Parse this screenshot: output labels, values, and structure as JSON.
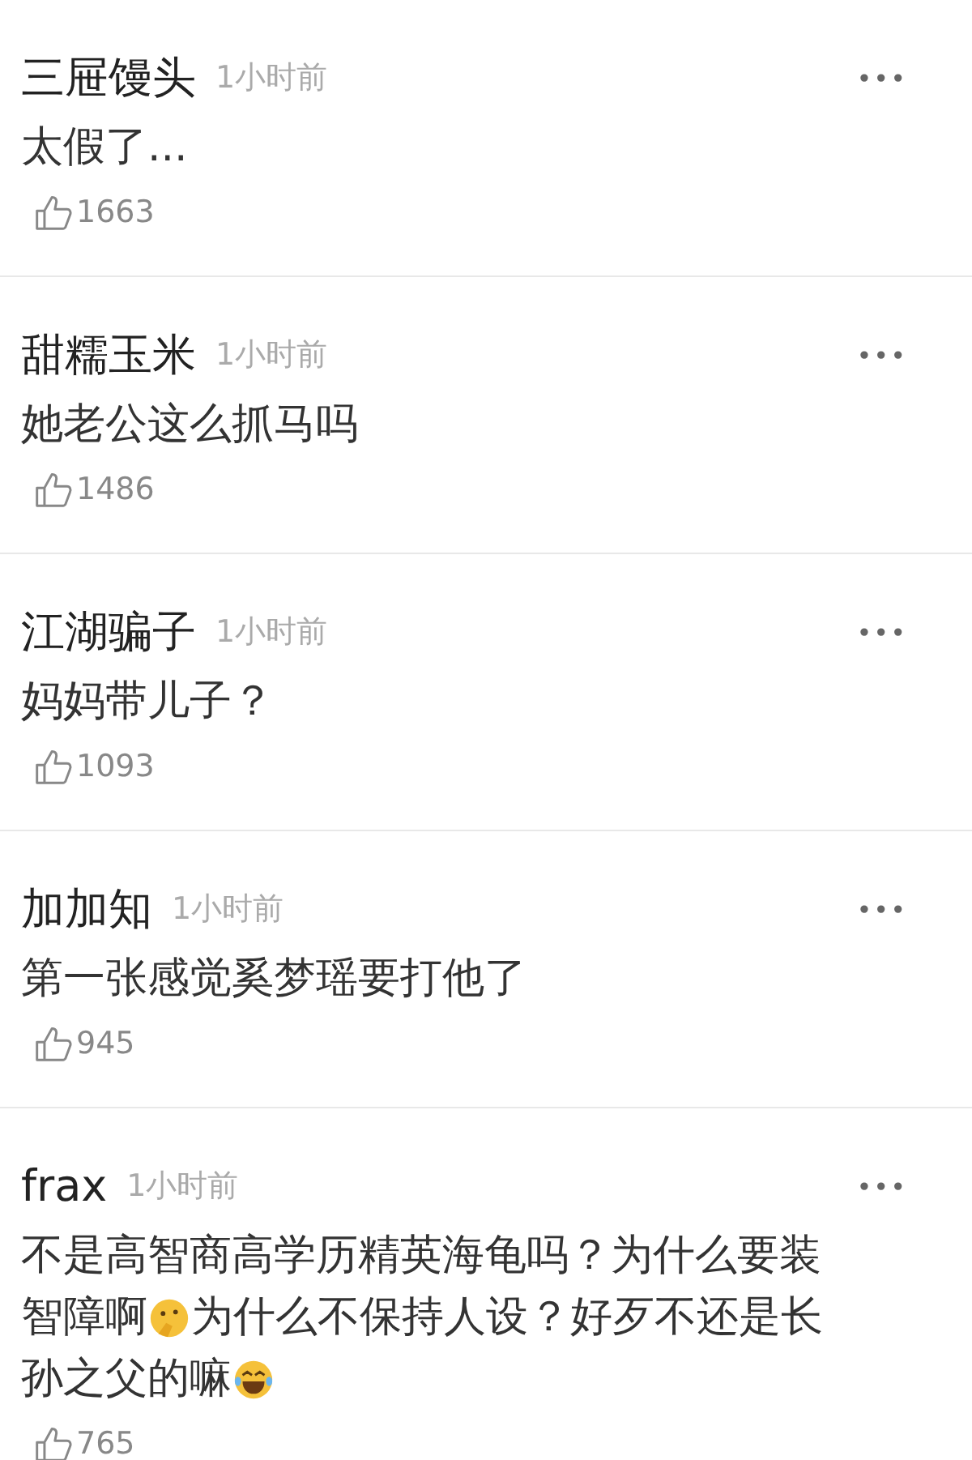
{
  "comments": [
    {
      "user": "三屉馒头",
      "time": "1小时前",
      "more": "•••",
      "lines": [
        [
          {
            "kind": "text",
            "text": "太假了..."
          }
        ]
      ],
      "likes": "1663"
    },
    {
      "user": "甜糯玉米",
      "time": "1小时前",
      "more": "•••",
      "lines": [
        [
          {
            "kind": "text",
            "text": "她老公这么抓马吗"
          }
        ]
      ],
      "likes": "1486"
    },
    {
      "user": "江湖骗子",
      "time": "1小时前",
      "more": "•••",
      "lines": [
        [
          {
            "kind": "text",
            "text": "妈妈带儿子？"
          }
        ]
      ],
      "likes": "1093"
    },
    {
      "user": "加加知",
      "time": "1小时前",
      "more": "•••",
      "lines": [
        [
          {
            "kind": "text",
            "text": "第一张感觉奚梦瑶要打他了"
          }
        ]
      ],
      "likes": "945"
    },
    {
      "user": "frax",
      "time": "1小时前",
      "more": "•••",
      "lines": [
        [
          {
            "kind": "text",
            "text": "不是高智商高学历精英海龟吗？为什么要装"
          }
        ],
        [
          {
            "kind": "text",
            "text": "智障啊"
          },
          {
            "kind": "thinking"
          },
          {
            "kind": "text",
            "text": "为什么不保持人设？好歹不还是长"
          }
        ],
        [
          {
            "kind": "text",
            "text": "孙之父的嘛"
          },
          {
            "kind": "laughing"
          }
        ]
      ],
      "likes": "765"
    }
  ]
}
